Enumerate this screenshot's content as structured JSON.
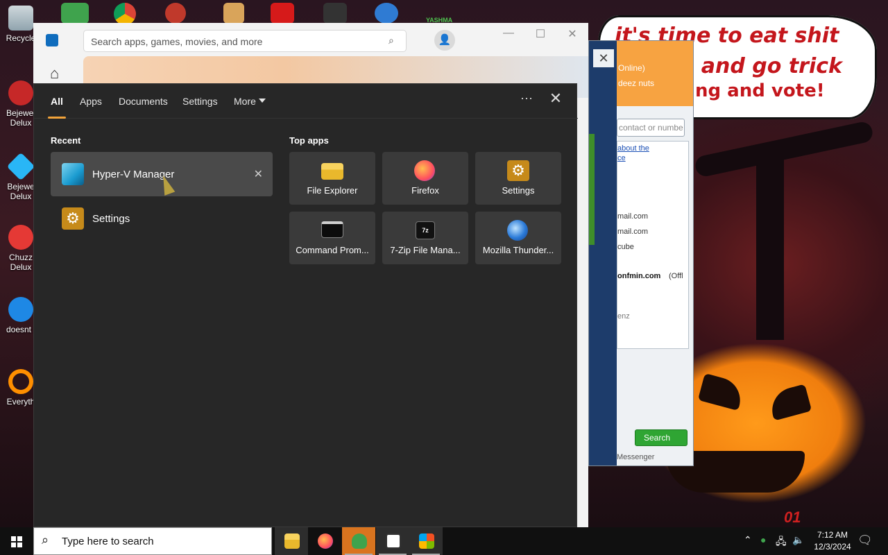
{
  "wallpaper": {
    "speech_lines": [
      "it's time to eat shit",
      "e and go trick",
      "ng and vote!"
    ],
    "corner_text": "01"
  },
  "desktop_icons": [
    {
      "label": "Recycle",
      "icon": "recycle-bin-icon"
    },
    {
      "label": "Bejewel Delux",
      "icon": "bejeweled-icon"
    },
    {
      "label": "Bejewe Delux",
      "icon": "diamond-icon"
    },
    {
      "label": "Chuzz Delux",
      "icon": "chuzzle-icon"
    },
    {
      "label": "doesnt l",
      "icon": "thunderbird-icon"
    },
    {
      "label": "Everyth",
      "icon": "everything-search-icon"
    }
  ],
  "top_icon_label": "YASHMA",
  "messenger": {
    "header_lines": [
      "Online)",
      "deez nuts"
    ],
    "search_placeholder": "contact or numbe",
    "link_lines": [
      "about the",
      "ce"
    ],
    "contacts": [
      "mail.com",
      "mail.com",
      "cube"
    ],
    "bold_contact": "onfmin.com",
    "bold_contact_status": "(Offl",
    "misc_line": "enz",
    "search_button": "Search",
    "footer": "Messenger",
    "close_glyph": "✕"
  },
  "store": {
    "search_placeholder": "Search apps, games, movies, and more",
    "controls": {
      "minimize": "—",
      "maximize": "☐",
      "close": "✕"
    }
  },
  "flyout": {
    "tabs": [
      {
        "label": "All",
        "active": true
      },
      {
        "label": "Apps"
      },
      {
        "label": "Documents"
      },
      {
        "label": "Settings"
      },
      {
        "label": "More"
      }
    ],
    "ellipsis": "···",
    "close": "✕",
    "recent_title": "Recent",
    "recent": [
      {
        "label": "Hyper-V Manager",
        "icon": "hyper-v-icon",
        "highlighted": true
      },
      {
        "label": "Settings",
        "icon": "settings-gear-icon"
      }
    ],
    "top_apps_title": "Top apps",
    "top_apps": [
      {
        "label": "File Explorer",
        "icon": "file-explorer-icon"
      },
      {
        "label": "Firefox",
        "icon": "firefox-icon"
      },
      {
        "label": "Settings",
        "icon": "settings-gear-icon"
      },
      {
        "label": "Command Prom...",
        "icon": "command-prompt-icon"
      },
      {
        "label": "7-Zip File Mana...",
        "icon": "7zip-icon"
      },
      {
        "label": "Mozilla Thunder...",
        "icon": "thunderbird-icon"
      }
    ]
  },
  "taskbar": {
    "search_placeholder": "Type here to search",
    "apps": [
      "file-explorer-icon",
      "firefox-icon",
      "messenger-icon",
      "solitaire-icon",
      "store-icon"
    ],
    "time": "7:12 AM",
    "date": "12/3/2024"
  },
  "colors": {
    "accent": "#f2a33a",
    "flyout_bg": "#272727",
    "tile_bg": "#3a3a3a",
    "taskbar_selected": "#d9741f"
  }
}
